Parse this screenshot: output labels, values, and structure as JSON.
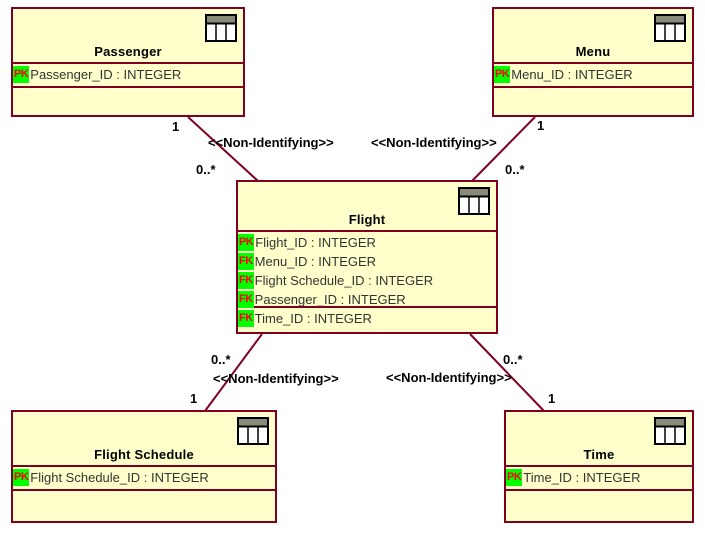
{
  "diagram": {
    "type": "entity-relationship-diagram",
    "colors": {
      "entity_fill": "#ffffcc",
      "entity_border": "#800020",
      "connector": "#800020",
      "key_badge_bg": "#00ff00",
      "key_badge_text": "#ff0000",
      "attribute_text": "#333333",
      "title_text": "#000000",
      "canvas": "#ffffff"
    },
    "entities": [
      {
        "id": "passenger",
        "name": "Passenger",
        "icon": "table-icon",
        "attributes": [
          {
            "key": "PK",
            "text": "Passenger_ID : INTEGER"
          }
        ]
      },
      {
        "id": "menu",
        "name": "Menu",
        "icon": "table-icon",
        "attributes": [
          {
            "key": "PK",
            "text": "Menu_ID : INTEGER"
          }
        ]
      },
      {
        "id": "flight",
        "name": "Flight",
        "icon": "table-icon",
        "attributes": [
          {
            "key": "PK",
            "text": "Flight_ID : INTEGER"
          },
          {
            "key": "FK",
            "text": "Menu_ID : INTEGER"
          },
          {
            "key": "FK",
            "text": "Flight Schedule_ID : INTEGER"
          },
          {
            "key": "FK",
            "text": "Passenger_ID : INTEGER"
          },
          {
            "key": "FK",
            "text": "Time_ID : INTEGER"
          }
        ]
      },
      {
        "id": "flight-schedule",
        "name": "Flight Schedule",
        "icon": "table-icon",
        "attributes": [
          {
            "key": "PK",
            "text": "Flight Schedule_ID : INTEGER"
          }
        ]
      },
      {
        "id": "time",
        "name": "Time",
        "icon": "table-icon",
        "attributes": [
          {
            "key": "PK",
            "text": "Time_ID : INTEGER"
          }
        ]
      }
    ],
    "relationships": [
      {
        "id": "passenger-flight",
        "from": "Passenger",
        "to": "Flight",
        "stereotype": "<<Non-Identifying>>",
        "from_multiplicity": "1",
        "to_multiplicity": "0..*"
      },
      {
        "id": "menu-flight",
        "from": "Menu",
        "to": "Flight",
        "stereotype": "<<Non-Identifying>>",
        "from_multiplicity": "1",
        "to_multiplicity": "0..*"
      },
      {
        "id": "flight-flight-schedule",
        "from": "Flight",
        "to": "Flight Schedule",
        "stereotype": "<<Non-Identifying>>",
        "from_multiplicity": "0..*",
        "to_multiplicity": "1"
      },
      {
        "id": "flight-time",
        "from": "Flight",
        "to": "Time",
        "stereotype": "<<Non-Identifying>>",
        "from_multiplicity": "0..*",
        "to_multiplicity": "1"
      }
    ]
  }
}
